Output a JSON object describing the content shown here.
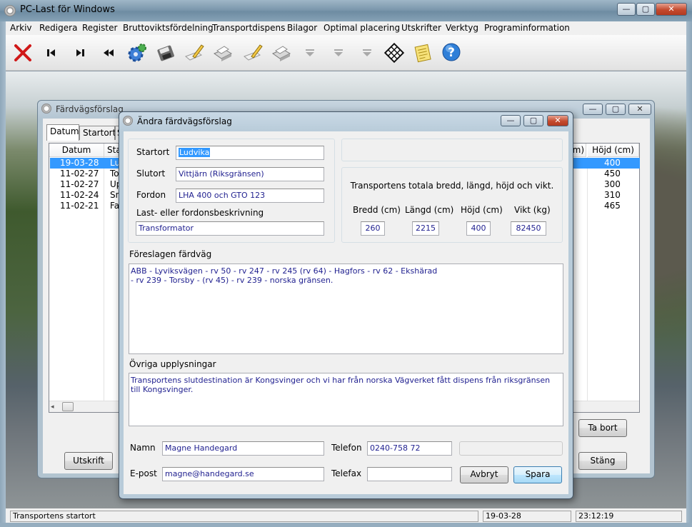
{
  "main_window": {
    "title": "PC-Last för Windows",
    "caption_buttons": [
      "minimize",
      "maximize",
      "close"
    ]
  },
  "menu": [
    "Arkiv",
    "Redigera",
    "Register",
    "Bruttoviktsfördelning",
    "Transportdispens",
    "Bilagor",
    "Optimal placering",
    "Utskrifter",
    "Verktyg",
    "Programinformation"
  ],
  "toolbar_icons": [
    "close-x-icon",
    "first-record-icon",
    "next-record-icon",
    "rewind-icon",
    "settings-gear-icon",
    "save-disk-icon",
    "edit-pencil-icon",
    "print-icon",
    "edit-pencil-icon",
    "print-icon",
    "arrow-down-disabled-icon",
    "arrow-down-disabled-icon",
    "arrow-down-disabled-icon",
    "calculator-icon",
    "notes-icon",
    "help-icon"
  ],
  "status_bar": {
    "message": "Transportens startort",
    "date": "19-03-28",
    "time": "23:12:19"
  },
  "background_dialog": {
    "title": "Färdvägsförslag",
    "tabs": [
      "Datum",
      "Startort",
      "S"
    ],
    "columns": [
      "Datum",
      "Sta",
      "m)",
      "Höjd (cm)"
    ],
    "rows": [
      {
        "datum": "19-03-28",
        "start": "Lu",
        "hojd": "400",
        "selected": true
      },
      {
        "datum": "11-02-27",
        "start": "To",
        "hojd": "450",
        "selected": false
      },
      {
        "datum": "11-02-27",
        "start": "Up",
        "hojd": "300",
        "selected": false
      },
      {
        "datum": "11-02-24",
        "start": "Sn",
        "hojd": "310",
        "selected": false
      },
      {
        "datum": "11-02-21",
        "start": "Fa",
        "hojd": "465",
        "selected": false
      }
    ],
    "buttons": {
      "print": "Utskrift",
      "delete": "Ta bort",
      "close": "Stäng"
    }
  },
  "dialog": {
    "title": "Ändra färdvägsförslag",
    "startort_label": "Startort",
    "startort_value": "Ludvika",
    "slutort_label": "Slutort",
    "slutort_value": "Vittjärn (Riksgränsen)",
    "fordon_label": "Fordon",
    "fordon_value": "LHA 400 och GTO 123",
    "beskrivning_label": "Last- eller fordonsbeskrivning",
    "beskrivning_value": "Transformator",
    "dimensions_title": "Transportens totala bredd, längd, höjd och vikt.",
    "bredd_label": "Bredd (cm)",
    "bredd_value": "260",
    "langd_label": "Längd (cm)",
    "langd_value": "2215",
    "hojd_label": "Höjd (cm)",
    "hojd_value": "400",
    "vikt_label": "Vikt (kg)",
    "vikt_value": "82450",
    "route_label": "Föreslagen färdväg",
    "route_line1": "ABB - Lyviksvägen - rv 50 - rv 247 - rv 245 (rv 64) - Hagfors - rv 62 - Ekshärad",
    "route_line2": "- rv 239 - Torsby - (rv 45) - rv 239 - norska gränsen.",
    "info_label": "Övriga upplysningar",
    "info_value": "Transportens slutdestination är Kongsvinger och vi har från norska Vägverket fått dispens från riksgränsen till Kongsvinger.",
    "namn_label": "Namn",
    "namn_value": "Magne Handegard",
    "telefon_label": "Telefon",
    "telefon_value": "0240-758 72",
    "epost_label": "E-post",
    "epost_value": "magne@handegard.se",
    "telefax_label": "Telefax",
    "telefax_value": "",
    "cancel_label": "Avbryt",
    "save_label": "Spara"
  }
}
